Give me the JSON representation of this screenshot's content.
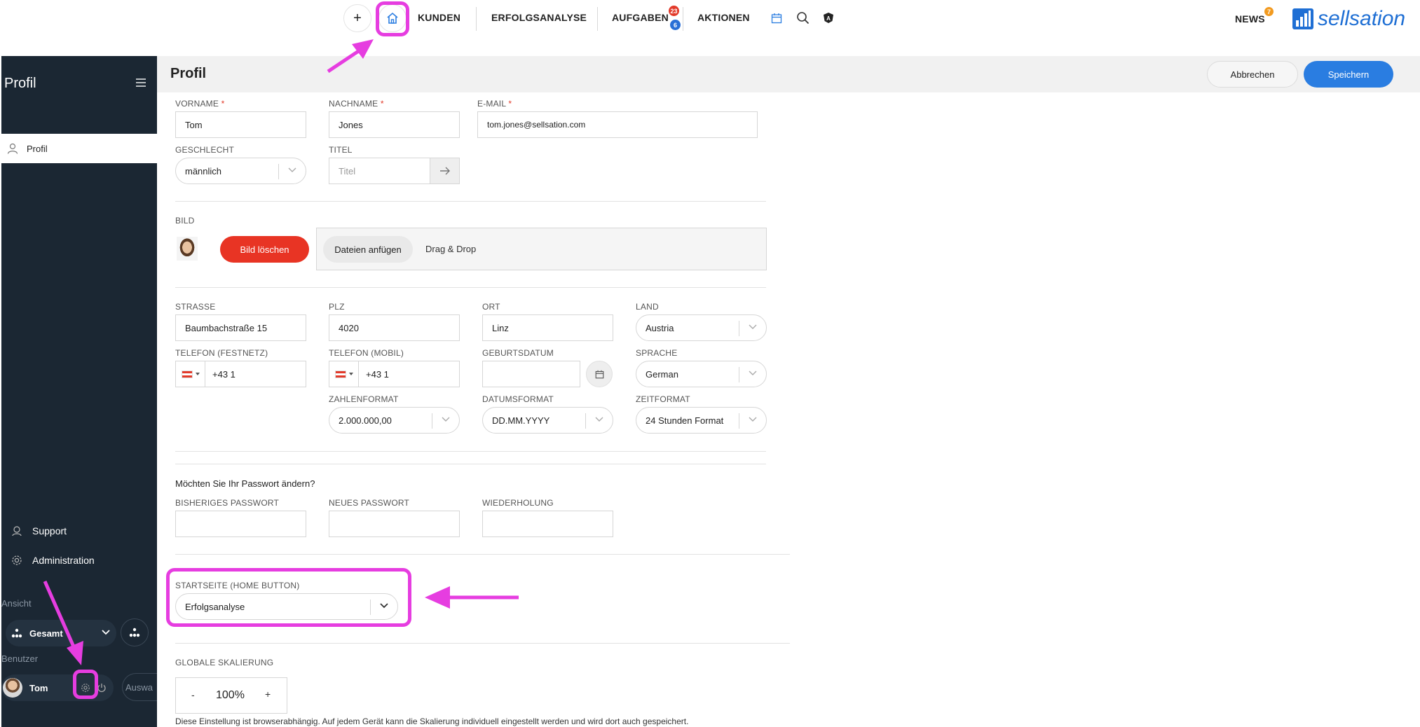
{
  "topbar": {
    "plus": "+",
    "nav": [
      "KUNDEN",
      "ERFOLGSANALYSE",
      "AUFGABEN",
      "AKTIONEN"
    ],
    "aufgaben_badge_red": "23",
    "aufgaben_badge_blue": "6",
    "news": "NEWS",
    "news_badge": "7",
    "logo_text": "sellsation",
    "colors": {
      "badge_red": "#e23a2a",
      "badge_blue": "#2a6fd6",
      "badge_orange": "#f29a1f",
      "logo_blue": "#1f6fd4"
    }
  },
  "sidebar": {
    "title": "Profil",
    "active_item": "Profil",
    "support": "Support",
    "administration": "Administration",
    "ansicht_label": "Ansicht",
    "ansicht_value": "Gesamt",
    "benutzer_label": "Benutzer",
    "user_name": "Tom",
    "auswahl_btn": "Auswa"
  },
  "header": {
    "title": "Profil",
    "cancel": "Abbrechen",
    "save": "Speichern",
    "colors": {
      "save_bg": "#2a7de1"
    }
  },
  "form": {
    "vorname": {
      "label": "VORNAME",
      "value": "Tom"
    },
    "nachname": {
      "label": "NACHNAME",
      "value": "Jones"
    },
    "email": {
      "label": "E-MAIL",
      "value": "tom.jones@sellsation.com"
    },
    "required_mark": "*",
    "geschlecht": {
      "label": "GESCHLECHT",
      "value": "männlich"
    },
    "titel": {
      "label": "TITEL",
      "placeholder": "Titel"
    },
    "bild": {
      "label": "BILD",
      "delete": "Bild löschen",
      "attach": "Dateien anfügen",
      "drag": "Drag & Drop"
    },
    "strasse": {
      "label": "STRASSE",
      "value": "Baumbachstraße 15"
    },
    "plz": {
      "label": "PLZ",
      "value": "4020"
    },
    "ort": {
      "label": "ORT",
      "value": "Linz"
    },
    "land": {
      "label": "LAND",
      "value": "Austria"
    },
    "tel_fest": {
      "label": "TELEFON (FESTNETZ)",
      "value": "+43 1"
    },
    "tel_mobil": {
      "label": "TELEFON (MOBIL)",
      "value": "+43 1"
    },
    "geburtsdatum": {
      "label": "GEBURTSDATUM",
      "value": ""
    },
    "sprache": {
      "label": "SPRACHE",
      "value": "German"
    },
    "zahlenformat": {
      "label": "ZAHLENFORMAT",
      "value": "2.000.000,00"
    },
    "datumsformat": {
      "label": "DATUMSFORMAT",
      "value": "DD.MM.YYYY"
    },
    "zeitformat": {
      "label": "ZEITFORMAT",
      "value": "24 Stunden Format"
    },
    "password_question": "Möchten Sie Ihr Passwort ändern?",
    "pw_old": {
      "label": "BISHERIGES PASSWORT"
    },
    "pw_new": {
      "label": "NEUES PASSWORT"
    },
    "pw_repeat": {
      "label": "WIEDERHOLUNG"
    },
    "startseite": {
      "label": "STARTSEITE (HOME BUTTON)",
      "value": "Erfolgsanalyse"
    },
    "skalierung": {
      "label": "GLOBALE SKALIERUNG",
      "minus": "-",
      "value": "100%",
      "plus": "+"
    },
    "skalierung_note": "Diese Einstellung ist browserabhängig. Auf jedem Gerät kann die Skalierung individuell eingestellt werden und wird dort auch gespeichert."
  },
  "annotation_color": "#e63de0"
}
